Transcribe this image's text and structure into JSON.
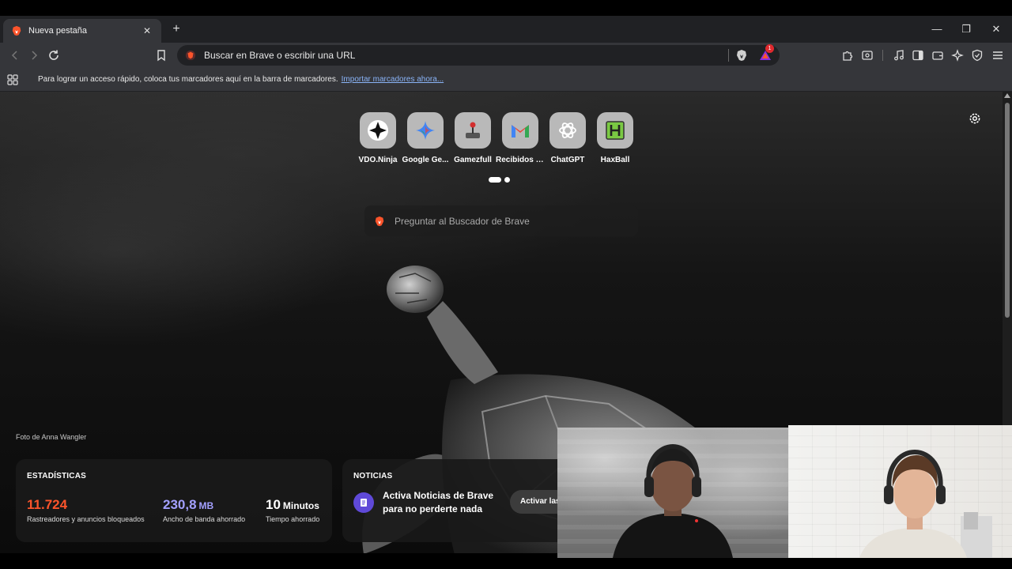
{
  "tab": {
    "title": "Nueva pestaña",
    "close": "✕",
    "new": "+"
  },
  "window": {
    "minimize": "—",
    "restore": "❐",
    "close": "✕"
  },
  "omnibox": {
    "text": "Buscar en Brave o escribir una URL",
    "rewards_badge": "1"
  },
  "bookmarks": {
    "message": "Para lograr un acceso rápido, coloca tus marcadores aquí en la barra de marcadores.",
    "import_link": "Importar marcadores ahora..."
  },
  "ntp": {
    "top_sites": [
      {
        "label": "VDO.Ninja",
        "icon": "vdo-ninja-icon"
      },
      {
        "label": "Google Ge...",
        "icon": "gemini-icon"
      },
      {
        "label": "Gamezfull",
        "icon": "joystick-icon"
      },
      {
        "label": "Recibidos (...",
        "icon": "gmail-icon"
      },
      {
        "label": "ChatGPT",
        "icon": "chatgpt-icon"
      },
      {
        "label": "HaxBall",
        "icon": "haxball-icon"
      }
    ],
    "search_placeholder": "Preguntar al Buscador de Brave",
    "photo_credit": "Foto de Anna Wangler",
    "stats": {
      "title": "ESTADÍSTICAS",
      "trackers": {
        "value": "11.724",
        "unit": "",
        "label": "Rastreadores y anuncios bloqueados",
        "color": "#fb542b"
      },
      "bandwidth": {
        "value": "230,8",
        "unit": "MB",
        "label": "Ancho de banda ahorrado",
        "color": "#a3a0ff"
      },
      "time": {
        "value": "10",
        "unit": "Minutos",
        "label": "Tiempo ahorrado",
        "color": "#ffffff"
      }
    },
    "news": {
      "title": "NOTICIAS",
      "text": "Activa Noticias de Brave para no perderte nada",
      "button": "Activar las"
    }
  },
  "colors": {
    "brave_orange": "#fb542b",
    "news_purple": "#5f49d8",
    "link_blue": "#8ab4f8"
  }
}
